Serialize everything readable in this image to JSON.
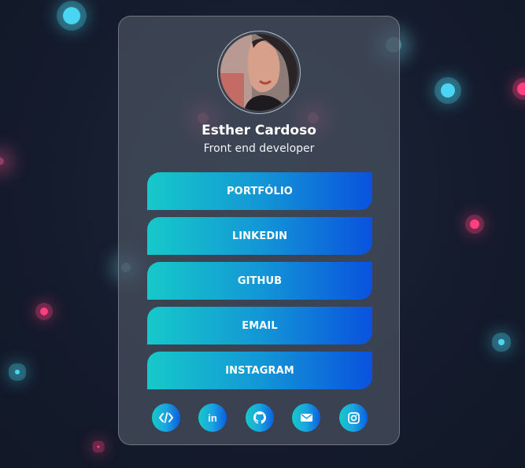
{
  "profile": {
    "name": "Esther Cardoso",
    "role": "Front end developer"
  },
  "links": [
    {
      "label": "PORTFÓLIO"
    },
    {
      "label": "LINKEDIN"
    },
    {
      "label": "GITHUB"
    },
    {
      "label": "EMAIL"
    },
    {
      "label": "INSTAGRAM"
    }
  ],
  "social_icons": [
    "code-icon",
    "linkedin-icon",
    "github-icon",
    "email-icon",
    "instagram-icon"
  ],
  "social_linkedin_text": "in",
  "colors": {
    "background": "#141c2e",
    "card": "#4a5260",
    "gradient_start": "#16c9c9",
    "gradient_end": "#0a52de",
    "particle_cyan": "#4ad6f2",
    "particle_pink": "#ff3f7e"
  }
}
